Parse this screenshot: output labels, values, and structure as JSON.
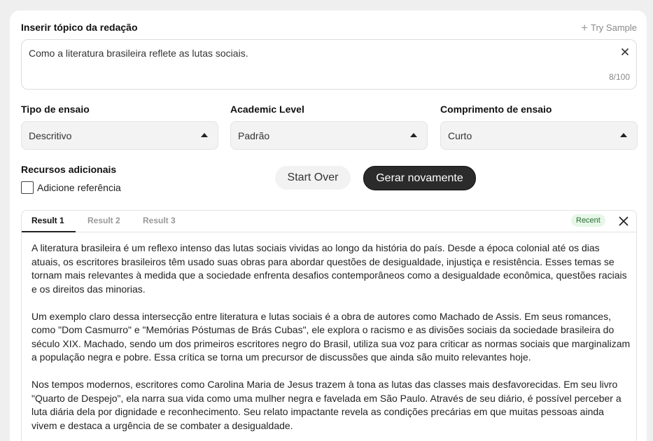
{
  "topic": {
    "label": "Inserir tópico da redação",
    "try_sample": "Try Sample",
    "value": "Como a literatura brasileira reflete as lutas sociais.",
    "counter": "8/100"
  },
  "selects": [
    {
      "label": "Tipo de ensaio",
      "value": "Descritivo"
    },
    {
      "label": "Academic Level",
      "value": "Padrão"
    },
    {
      "label": "Comprimento de ensaio",
      "value": "Curto"
    }
  ],
  "resources": {
    "label": "Recursos adicionais",
    "checkbox_label": "Adicione referência"
  },
  "buttons": {
    "start_over": "Start Over",
    "regenerate": "Gerar novamente"
  },
  "results": {
    "tabs": [
      "Result 1",
      "Result 2",
      "Result 3"
    ],
    "badge": "Recent",
    "paragraphs": [
      "A literatura brasileira é um reflexo intenso das lutas sociais vividas ao longo da história do país. Desde a época colonial até os dias atuais, os escritores brasileiros têm usado suas obras para abordar questões de desigualdade, injustiça e resistência. Esses temas se tornam mais relevantes à medida que a sociedade enfrenta desafios contemporâneos como a desigualdade econômica, questões raciais e os direitos das minorias.",
      "Um exemplo claro dessa intersecção entre literatura e lutas sociais é a obra de autores como Machado de Assis. Em seus romances, como \"Dom Casmurro\" e \"Memórias Póstumas de Brás Cubas\", ele explora o racismo e as divisões sociais da sociedade brasileira do século XIX. Machado, sendo um dos primeiros escritores negro do Brasil, utiliza sua voz para criticar as normas sociais que marginalizam a população negra e pobre. Essa crítica se torna um precursor de discussões que ainda são muito relevantes hoje.",
      "Nos tempos modernos, escritores como Carolina Maria de Jesus trazem à tona as lutas das classes mais desfavorecidas. Em seu livro \"Quarto de Despejo\", ela narra sua vida como uma mulher negra e favelada em São Paulo. Através de seu diário, é possível perceber a luta diária dela por dignidade e reconhecimento. Seu relato impactante revela as condições precárias em que muitas pessoas ainda vivem e destaca a urgência de se combater a desigualdade."
    ]
  }
}
